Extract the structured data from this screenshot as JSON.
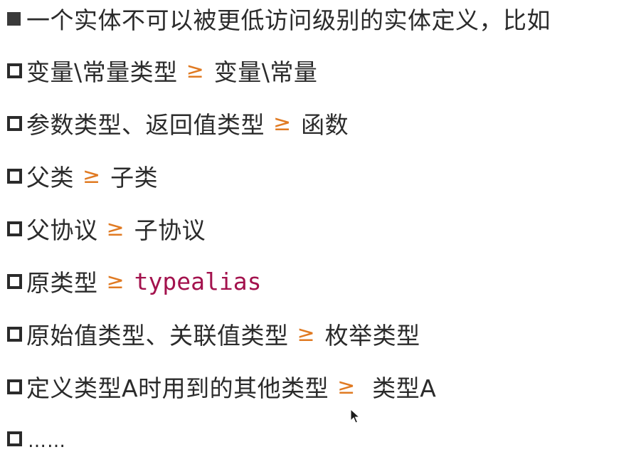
{
  "headline": "一个实体不可以被更低访问级别的实体定义，比如",
  "rules": [
    {
      "lhs": "变量\\常量类型",
      "op": "≥",
      "rhs": "变量\\常量"
    },
    {
      "lhs": "参数类型、返回值类型",
      "op": "≥",
      "rhs": "函数"
    },
    {
      "lhs": "父类",
      "op": "≥",
      "rhs": "子类"
    },
    {
      "lhs": "父协议",
      "op": "≥",
      "rhs": "子协议"
    },
    {
      "lhs": "原类型",
      "op": "≥",
      "rhs": "typealias"
    },
    {
      "lhs": "原始值类型、关联值类型",
      "op": "≥",
      "rhs": "枚举类型"
    },
    {
      "lhs": "定义类型A时用到的其他类型",
      "op": "≥",
      "rhs": "类型A"
    }
  ],
  "ellipsis": "……",
  "colors": {
    "text": "#2b2b2b",
    "operator": "#e07a22",
    "code": "#a3124d"
  },
  "icons": {
    "headline_bullet": "filled-square-bullet-icon",
    "item_bullet": "hollow-square-bullet-icon",
    "cursor": "mouse-pointer-icon"
  }
}
